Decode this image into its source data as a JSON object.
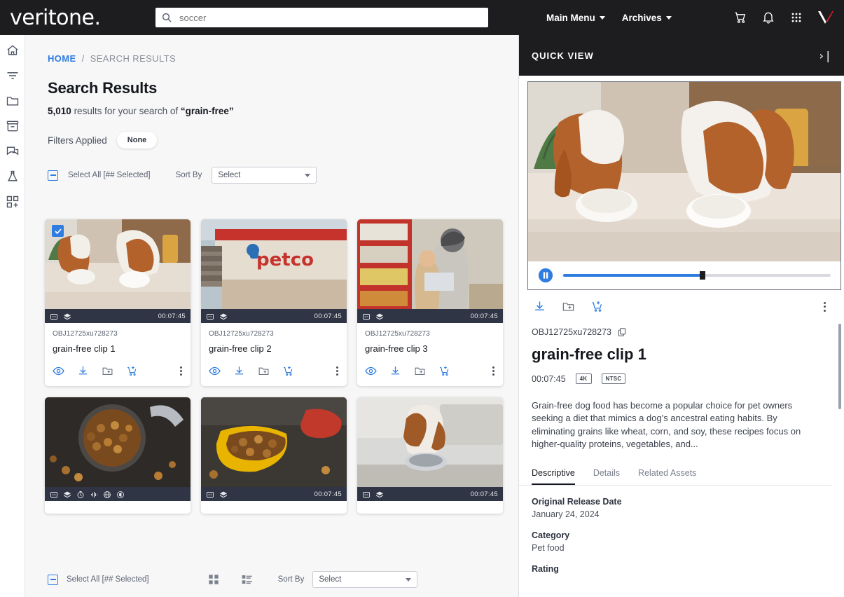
{
  "topbar": {
    "logo": "veritone",
    "search": {
      "value": "soccer",
      "placeholder": "soccer",
      "icon": "search-icon"
    },
    "menus": [
      {
        "label": "Main Menu",
        "icon": "chevron-down-icon"
      },
      {
        "label": "Archives",
        "icon": "chevron-down-icon"
      }
    ],
    "icons": [
      "cart-icon",
      "bell-icon",
      "apps-grid-icon",
      "veritone-v-icon"
    ]
  },
  "rail": {
    "items": [
      {
        "name": "home-icon",
        "label": "Home"
      },
      {
        "name": "filter-icon",
        "label": "Filter"
      },
      {
        "name": "folder-icon",
        "label": "Folders"
      },
      {
        "name": "archive-icon",
        "label": "Archive"
      },
      {
        "name": "chat-icon",
        "label": "Messages"
      },
      {
        "name": "flask-icon",
        "label": "Labs"
      },
      {
        "name": "add-widget-icon",
        "label": "Add"
      }
    ]
  },
  "breadcrumb": {
    "home": "HOME",
    "separator": "/",
    "current": "SEARCH RESULTS"
  },
  "results": {
    "title": "Search Results",
    "count": "5,010",
    "count_suffix": "results for your search of",
    "query": "“grain-free”",
    "filters_label": "Filters Applied",
    "filters_chip": "None",
    "select_all": "Select All [## Selected]",
    "sort_by_label": "Sort By",
    "sort_value": "Select"
  },
  "bottom_toolbar": {
    "select_all": "Select All [## Selected]",
    "grid_view_icon": "grid-view-icon",
    "list_view_icon": "list-view-icon",
    "sort_by_label": "Sort By",
    "sort_value": "Select"
  },
  "cards": [
    {
      "id": "OBJ12725xu728273",
      "title": "grain-free clip 1",
      "duration": "00:07:45",
      "selected": true,
      "overlay_icons": [
        "closed-caption-icon",
        "layers-icon"
      ],
      "actions": [
        "eye-icon",
        "download-icon",
        "add-to-folder-icon",
        "add-to-cart-icon",
        "more-options-icon"
      ],
      "thumb": "two-cavalier-dogs-eating-from-bowls"
    },
    {
      "id": "OBJ12725xu728273",
      "title": "grain-free clip 2",
      "duration": "00:07:45",
      "selected": false,
      "overlay_icons": [
        "closed-caption-icon",
        "layers-icon"
      ],
      "actions": [
        "eye-icon",
        "download-icon",
        "add-to-folder-icon",
        "add-to-cart-icon",
        "more-options-icon"
      ],
      "thumb": "petco-storefront"
    },
    {
      "id": "OBJ12725xu728273",
      "title": "grain-free clip 3",
      "duration": "00:07:45",
      "selected": false,
      "overlay_icons": [
        "closed-caption-icon",
        "layers-icon"
      ],
      "actions": [
        "eye-icon",
        "download-icon",
        "add-to-folder-icon",
        "add-to-cart-icon",
        "more-options-icon"
      ],
      "thumb": "woman-and-child-shopping-pet-aisle"
    },
    {
      "id": "",
      "title": "",
      "duration": "",
      "selected": false,
      "overlay_icons": [
        "closed-caption-icon",
        "layers-icon",
        "clock-icon",
        "audio-icon",
        "globe-icon",
        "speaker-icon"
      ],
      "actions": [],
      "thumb": "kibble-in-metal-bowl-overhead"
    },
    {
      "id": "",
      "title": "",
      "duration": "00:07:45",
      "selected": false,
      "overlay_icons": [
        "closed-caption-icon",
        "layers-icon"
      ],
      "actions": [],
      "thumb": "yellow-bowl-of-kibble"
    },
    {
      "id": "",
      "title": "",
      "duration": "00:07:45",
      "selected": false,
      "overlay_icons": [
        "closed-caption-icon",
        "layers-icon"
      ],
      "actions": [],
      "thumb": "beagle-eating-from-bowl"
    }
  ],
  "quick_view": {
    "header": "QUICK VIEW",
    "collapse_icon": "›|",
    "player": {
      "play_state": "pause-icon",
      "progress_percent": 52,
      "poster": "two-cavalier-dogs-eating-from-bowls"
    },
    "actions": [
      "download-icon",
      "add-to-folder-icon",
      "add-to-cart-icon",
      "more-options-icon"
    ],
    "asset_id": "OBJ12725xu728273",
    "copy_icon": "copy-icon",
    "title": "grain-free clip 1",
    "duration": "00:07:45",
    "badges": [
      "4K",
      "NTSC"
    ],
    "description": "Grain-free dog food has become a popular choice for pet owners seeking a diet that mimics a dog's ancestral eating habits. By eliminating grains like wheat, corn, and soy, these recipes focus on higher-quality proteins, vegetables, and...",
    "tabs": [
      {
        "label": "Descriptive",
        "active": true
      },
      {
        "label": "Details",
        "active": false
      },
      {
        "label": "Related Assets",
        "active": false
      }
    ],
    "fields": [
      {
        "label": "Original Release Date",
        "value": "January 24, 2024"
      },
      {
        "label": "Category",
        "value": "Pet food"
      },
      {
        "label": "Rating",
        "value": ""
      }
    ]
  },
  "colors": {
    "accent": "#2f7de1",
    "dark": "#1d1d1f",
    "overlay_bar": "#2f3544",
    "page_bg": "#f7f7f8",
    "brand_red": "#e5202e"
  }
}
